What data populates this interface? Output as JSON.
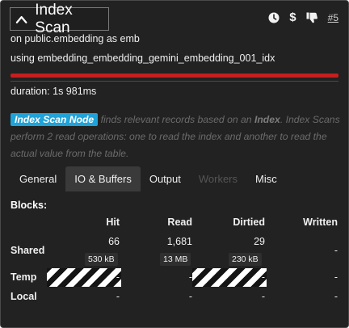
{
  "header": {
    "title": "Index Scan",
    "node_link": "#5",
    "icons": [
      "clock-icon",
      "dollar-icon",
      "thumbs-down-icon"
    ],
    "dollar_glyph": "$"
  },
  "info": {
    "line1": "on public.embedding as emb",
    "line2": "using embedding_embedding_gemini_embedding_001_idx",
    "duration": "duration: 1s 981ms",
    "duration_bar_color": "#c81e1e"
  },
  "description": {
    "badge": "Index Scan Node",
    "text1": " finds relevant records based on an ",
    "bold": "Index",
    "text2": ". Index Scans perform 2 read operations: one to read the index and another to read the actual value from the table."
  },
  "tabs": [
    {
      "label": "General",
      "active": false,
      "disabled": false
    },
    {
      "label": "IO & Buffers",
      "active": true,
      "disabled": false
    },
    {
      "label": "Output",
      "active": false,
      "disabled": false
    },
    {
      "label": "Workers",
      "active": false,
      "disabled": true
    },
    {
      "label": "Misc",
      "active": false,
      "disabled": false
    }
  ],
  "blocks": {
    "label": "Blocks:",
    "columns": [
      "Hit",
      "Read",
      "Dirtied",
      "Written"
    ],
    "rows": {
      "shared": {
        "label": "Shared",
        "hit": "66",
        "hit_size": "530 kB",
        "read": "1,681",
        "read_size": "13 MB",
        "dirtied": "29",
        "dirtied_size": "230 kB",
        "written": "-"
      },
      "temp": {
        "label": "Temp",
        "hit": "-",
        "read": "-",
        "dirtied": "-",
        "written": "-"
      },
      "local": {
        "label": "Local",
        "hit": "-",
        "read": "-",
        "dirtied": "-",
        "written": "-"
      }
    }
  }
}
